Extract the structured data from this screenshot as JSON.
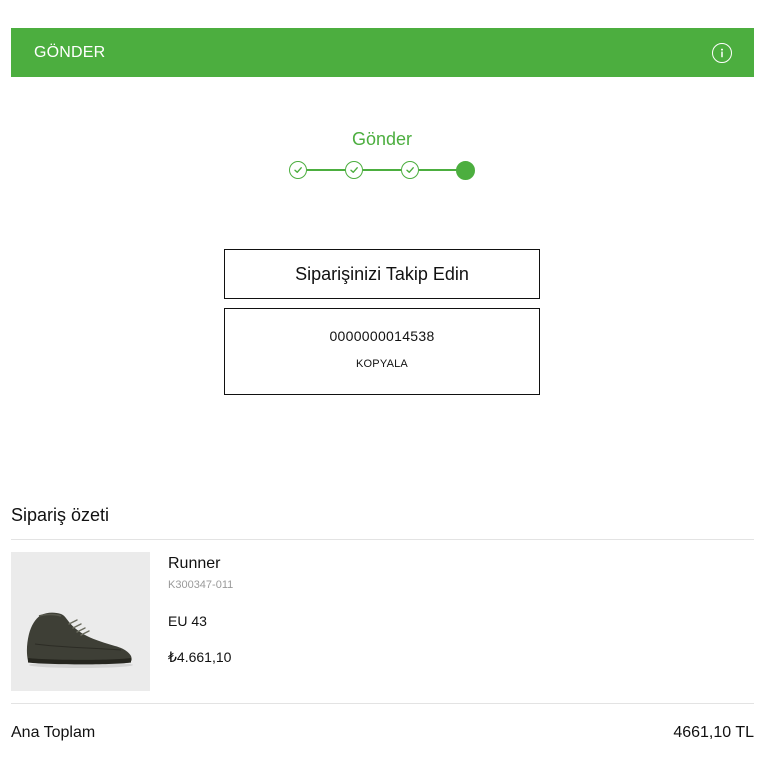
{
  "header": {
    "title": "GÖNDER",
    "info_icon": "info-icon"
  },
  "stepper": {
    "title": "Gönder",
    "steps": [
      {
        "state": "completed",
        "icon": "check-icon"
      },
      {
        "state": "completed",
        "icon": "check-icon"
      },
      {
        "state": "completed",
        "icon": "check-icon"
      },
      {
        "state": "active",
        "icon": "dot"
      }
    ],
    "active_index": 4,
    "total_steps": 4
  },
  "tracking": {
    "label": "Siparişinizi Takip Edin",
    "order_number": "0000000014538",
    "copy_label": "KOPYALA"
  },
  "summary": {
    "title": "Sipariş özeti",
    "items": [
      {
        "name": "Runner",
        "sku": "K300347-011",
        "size": "EU 43",
        "price": "₺4.661,10",
        "image_icon": "shoe-image"
      }
    ],
    "total_label": "Ana Toplam",
    "total_value": "4661,10 TL"
  },
  "colors": {
    "accent": "#4cae3f",
    "text": "#111111",
    "muted": "#9a9a9a",
    "image_bg": "#ebebeb"
  }
}
